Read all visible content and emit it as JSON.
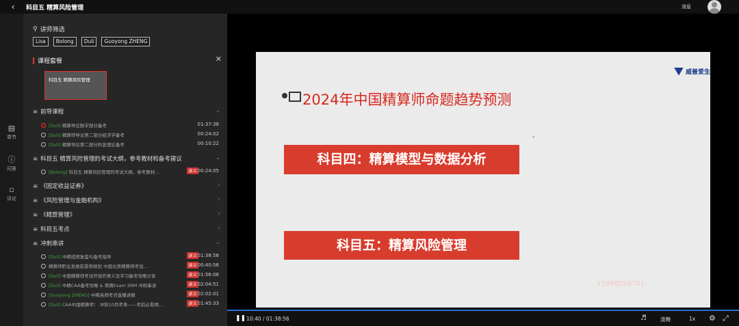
{
  "topbar": {
    "back_icon": "chevron-left-icon",
    "title": "科目五 精算风险管理",
    "messages": "消息"
  },
  "rail": [
    {
      "icon": "chapters-icon",
      "label": "章节"
    },
    {
      "icon": "question-icon",
      "label": "问答"
    },
    {
      "icon": "comment-icon",
      "label": "评论"
    }
  ],
  "filter": {
    "label": "讲师筛选",
    "chips": [
      "Lisa",
      "Bolong",
      "Duli",
      "Guoyong ZHENG"
    ]
  },
  "course_section": {
    "label": "课程套餐",
    "card": "科目五 精算风险管理"
  },
  "groups": [
    {
      "title": "前导课程",
      "lessons": [
        {
          "tag": "[Duli]",
          "title": "精算导论数学部分备考",
          "duration": "01:37:38",
          "active": true,
          "badge": ""
        },
        {
          "tag": "[Duli]",
          "title": "精算师导论第二部分经济学备考",
          "duration": "00:24:02",
          "active": false,
          "badge": ""
        },
        {
          "tag": "[Duli]",
          "title": "精算导论第二部分利息理论备考",
          "duration": "00:10:22",
          "active": false,
          "badge": ""
        }
      ]
    },
    {
      "title": "科目五 精算风险管理的考试大纲，参考教材和备考建议",
      "lessons": [
        {
          "tag": "[Bolong]",
          "title": "科目五 精算风险管理的考试大纲，参考教材...",
          "duration": "00:24:05",
          "active": false,
          "badge": "讲义"
        }
      ]
    },
    {
      "title": "《固定收益证券》",
      "lessons": []
    },
    {
      "title": "《风险管理与金融机构》",
      "lessons": []
    },
    {
      "title": "《精算管理》",
      "lessons": []
    },
    {
      "title": "科目五考点",
      "lessons": []
    },
    {
      "title": "冲刺串讲",
      "lessons": [
        {
          "tag": "[Duli]",
          "title": "中精成绩复盘与备考指导",
          "duration": "01:38:56",
          "active": false,
          "badge": "讲义"
        },
        {
          "tag": "",
          "title": "精算师职业发展前景和规划 中国北美精算师考径...",
          "duration": "00:40:56",
          "active": false,
          "badge": "讲义"
        },
        {
          "tag": "[Duli]",
          "title": "中国精算师考试开放的意义及学习备考攻略分享",
          "duration": "01:56:06",
          "active": false,
          "badge": "讲义"
        },
        {
          "tag": "[Duli]",
          "title": "中精CAA备考攻略 & 美精Exam SRM 冲刺串讲",
          "duration": "02:04:51",
          "active": false,
          "badge": "讲义"
        },
        {
          "tag": "[Guoyong ZHENG]",
          "title": "中精高频考点直播讲解",
          "duration": "02:02:01",
          "active": false,
          "badge": "讲义"
        },
        {
          "tag": "[Duli]",
          "title": "CAA中国精算师： 冲刺10月考季——考前必看预...",
          "duration": "01:45:33",
          "active": false,
          "badge": "讲义"
        }
      ]
    }
  ],
  "slide": {
    "logo": "威普爱生",
    "title": "2024年中国精算师命题趋势预测",
    "box1": "科目四：精算模型与数据分析",
    "box2": "科目五：精算风险管理",
    "watermark": "13988559701"
  },
  "controls": {
    "time": "10:40 / 01:38:56",
    "quality": "流畅",
    "speed": "1x"
  },
  "colors": {
    "accent": "#e0362c",
    "progress": "#2f6fd6",
    "tag_green": "#3fa43f"
  }
}
